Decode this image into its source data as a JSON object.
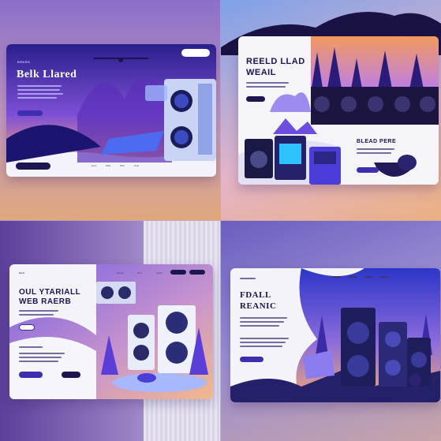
{
  "panel1": {
    "title": "Belk Llared",
    "eyebrow": "ERKES",
    "nav": [
      "Hom",
      "Pbat",
      "Sbct",
      "Cols"
    ]
  },
  "panel2": {
    "title_line1": "REELD LLAD",
    "title_line2": "WEAIL",
    "subtitle": "BLEAD PERE"
  },
  "panel3": {
    "title_line1": "OUL YTARIALL",
    "title_line2": "WEB RAERB",
    "nav": [
      "Serd",
      "Pieras",
      "Dart",
      "Sedrd",
      "Cols"
    ]
  },
  "panel4": {
    "title_line1": "FDALL",
    "title_line2": "REANIC"
  },
  "colors": {
    "navy": "#1c1650",
    "accent": "#6c4de0",
    "purple": "#7b55e6"
  }
}
